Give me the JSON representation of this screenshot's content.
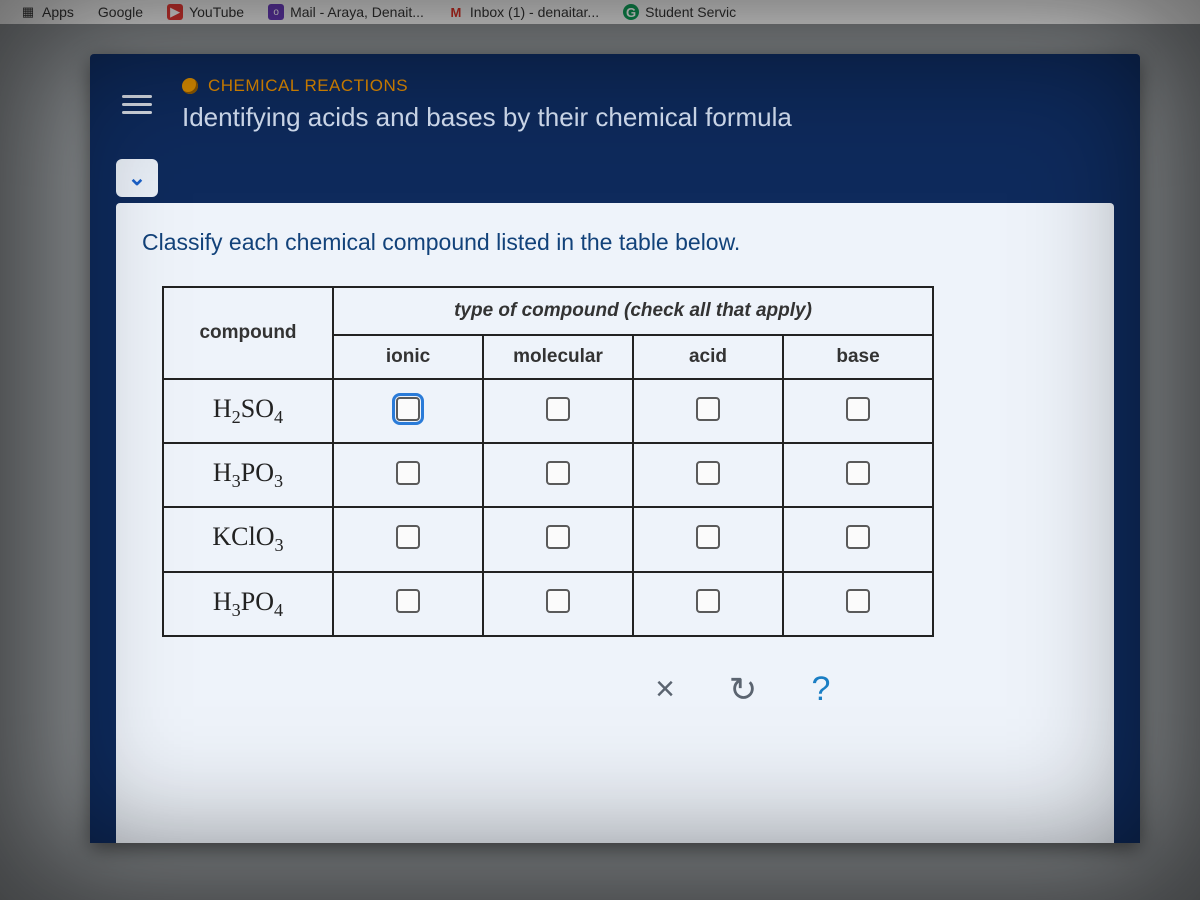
{
  "bookmarks": {
    "apps": "Apps",
    "google": "Google",
    "youtube": "YouTube",
    "mail": "Mail - Araya, Denait...",
    "inbox": "Inbox (1) - denaitar...",
    "student": "Student Servic"
  },
  "header": {
    "subject": "CHEMICAL REACTIONS",
    "lesson": "Identifying acids and bases by their chemical formula"
  },
  "instruction": "Classify each chemical compound listed in the table below.",
  "table": {
    "compound_header": "compound",
    "type_header": "type of compound (check all that apply)",
    "columns": {
      "ionic": "ionic",
      "molecular": "molecular",
      "acid": "acid",
      "base": "base"
    },
    "rows": [
      {
        "formula_display": "H",
        "sub1": "2",
        "mid": "SO",
        "sub2": "4",
        "ionic": false,
        "molecular": false,
        "acid": false,
        "base": false,
        "focus": "ionic"
      },
      {
        "formula_display": "H",
        "sub1": "3",
        "mid": "PO",
        "sub2": "3",
        "ionic": false,
        "molecular": false,
        "acid": false,
        "base": false
      },
      {
        "formula_display": "KClO",
        "sub1": "",
        "mid": "",
        "sub2": "3",
        "ionic": false,
        "molecular": false,
        "acid": false,
        "base": false
      },
      {
        "formula_display": "H",
        "sub1": "3",
        "mid": "PO",
        "sub2": "4",
        "ionic": false,
        "molecular": false,
        "acid": false,
        "base": false
      }
    ]
  },
  "actions": {
    "clear": "×",
    "reset": "↻",
    "help": "?"
  }
}
